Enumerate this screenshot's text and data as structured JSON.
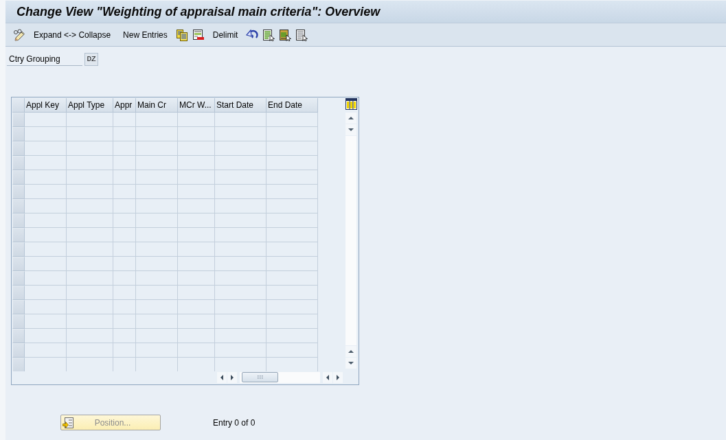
{
  "window": {
    "title": "Change View \"Weighting of appraisal main criteria\": Overview"
  },
  "toolbar": [
    {
      "kind": "toggle"
    },
    {
      "kind": "text",
      "label": "Expand <-> Collapse"
    },
    {
      "kind": "text",
      "label": "New Entries"
    },
    {
      "kind": "copy"
    },
    {
      "kind": "delete"
    },
    {
      "kind": "text",
      "label": "Delimit"
    },
    {
      "kind": "undo"
    },
    {
      "kind": "selectall"
    },
    {
      "kind": "selectblock"
    },
    {
      "kind": "deselect"
    }
  ],
  "fields": [
    {
      "label": "Ctry Grouping",
      "value": "DZ"
    }
  ],
  "table": {
    "columns": [
      "Appl Key",
      "Appl Type",
      "Appr",
      "Main Cr",
      "MCr W...",
      "Start Date",
      "End Date"
    ]
  },
  "footer": {
    "position_button": {
      "label": "Position...",
      "disabled": true
    },
    "entry_count": "Entry 0 of 0"
  }
}
